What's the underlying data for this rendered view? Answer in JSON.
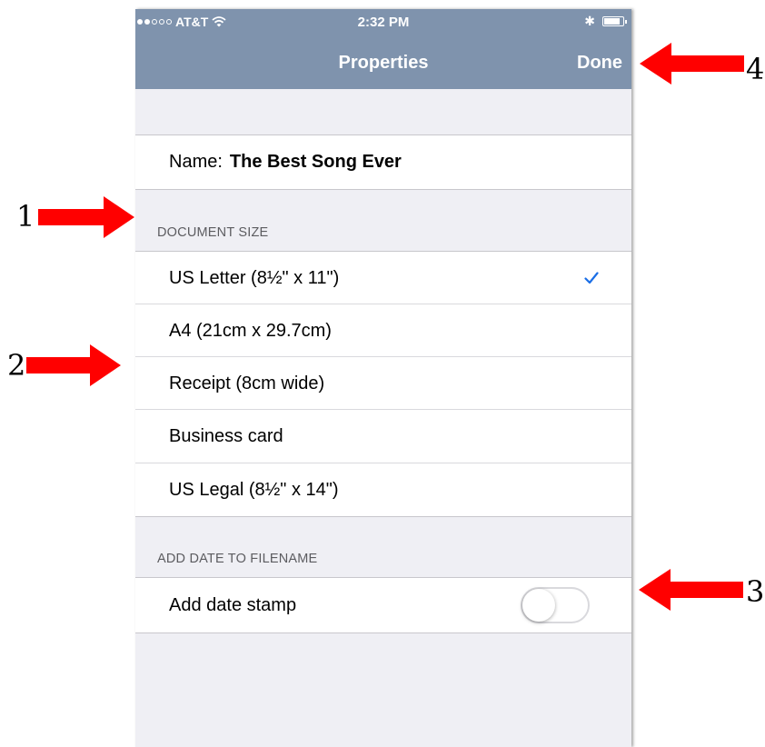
{
  "status_bar": {
    "signal_full": 2,
    "signal_empty": 3,
    "carrier": "AT&T",
    "time": "2:32 PM",
    "battery_level": 0.75
  },
  "navbar": {
    "title": "Properties",
    "done_label": "Done"
  },
  "name_row": {
    "label": "Name:",
    "value": "The Best Song Ever"
  },
  "document_size": {
    "header": "DOCUMENT SIZE",
    "options": [
      {
        "label": "US Letter (8½\" x 11\")",
        "selected": true
      },
      {
        "label": "A4 (21cm x 29.7cm)",
        "selected": false
      },
      {
        "label": "Receipt (8cm wide)",
        "selected": false
      },
      {
        "label": "Business card",
        "selected": false
      },
      {
        "label": "US Legal (8½\" x 14\")",
        "selected": false
      }
    ]
  },
  "date_section": {
    "header": "ADD DATE TO FILENAME",
    "row_label": "Add date stamp",
    "toggle_on": false
  },
  "annotations": [
    "1",
    "2",
    "3",
    "4"
  ],
  "colors": {
    "navbar": "#7f93ad",
    "accent": "#1a6ee6",
    "arrow": "#ff0000",
    "background": "#efeff4"
  }
}
